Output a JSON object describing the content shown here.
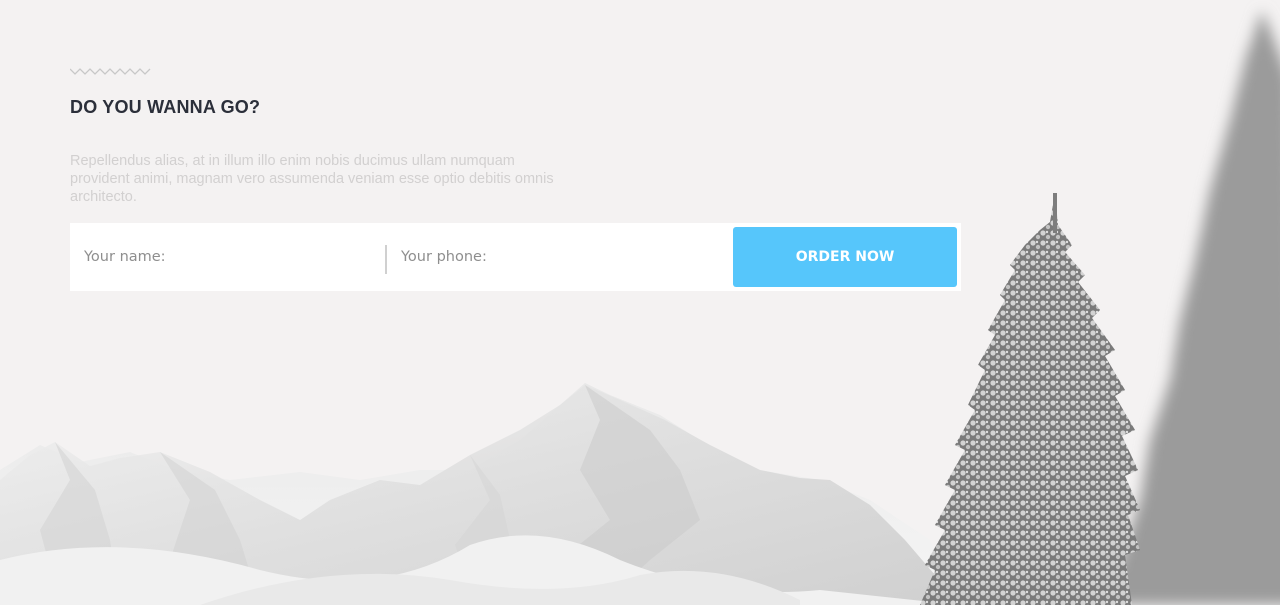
{
  "hero": {
    "heading": "DO YOU WANNA GO?",
    "description": "Repellendus alias, at in illum illo enim nobis ducimus ullam numquam provident animi, magnam vero assumenda veniam esse optio debitis omnis architecto."
  },
  "order_form": {
    "name_placeholder": "Your name:",
    "phone_placeholder": "Your phone:",
    "submit_label": "ORDER NOW"
  },
  "colors": {
    "background": "#f4f2f2",
    "heading": "#2b2f3a",
    "description": "#d2d0d0",
    "button": "#56c6fb",
    "button_text": "#ffffff"
  },
  "icons": {
    "divider": "zigzag-divider-icon"
  }
}
